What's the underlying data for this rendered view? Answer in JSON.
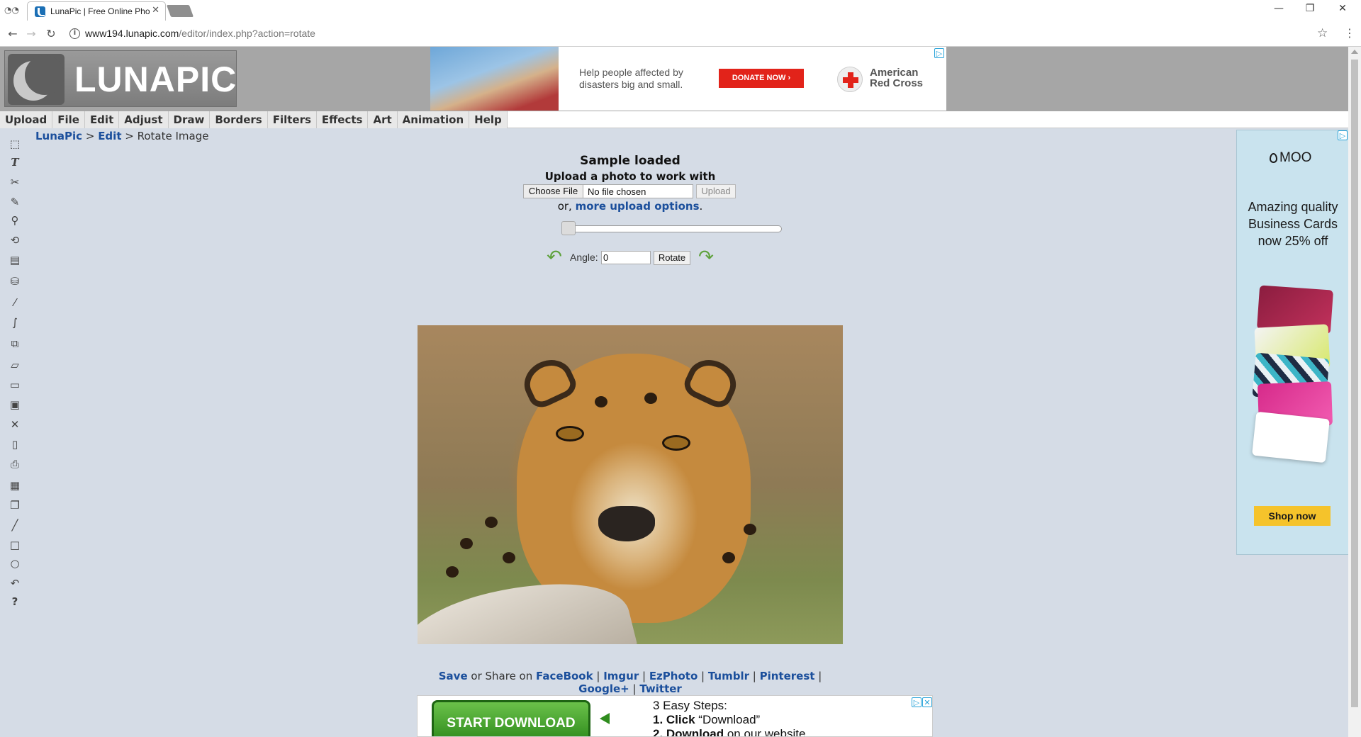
{
  "browser": {
    "tab_title": "LunaPic | Free Online Pho",
    "url_host": "www194.lunapic.com",
    "url_path": "/editor/index.php?action=rotate"
  },
  "logo": {
    "text": "LUNAPIC"
  },
  "top_ad": {
    "message": "Help people affected by disasters big and small.",
    "button": "DONATE NOW ›",
    "org_line1": "American",
    "org_line2": "Red Cross"
  },
  "menu": [
    "Upload",
    "File",
    "Edit",
    "Adjust",
    "Draw",
    "Borders",
    "Filters",
    "Effects",
    "Art",
    "Animation",
    "Help"
  ],
  "breadcrumb": {
    "home": "LunaPic",
    "sep1": " > ",
    "section": "Edit",
    "sep2": " > ",
    "current": "Rotate Image"
  },
  "upload": {
    "status": "Sample loaded",
    "prompt": "Upload a photo to work with",
    "choose_file": "Choose File",
    "no_file": "No file chosen",
    "upload_button": "Upload",
    "or_text": "or, ",
    "more_options": "more upload options",
    "period": "."
  },
  "rotate": {
    "slider_value": 0,
    "angle_label": "Angle:",
    "angle_value": "0",
    "rotate_button": "Rotate"
  },
  "share": {
    "save": "Save",
    "or_share": " or Share on ",
    "links": [
      "FaceBook",
      "Imgur",
      "EzPhoto",
      "Tumblr",
      "Pinterest",
      "Google+",
      "Twitter"
    ],
    "sep": " | "
  },
  "bottom_ad": {
    "button": "START DOWNLOAD",
    "steps_title": "3 Easy Steps:",
    "step1_bold": "1. Click",
    "step1_rest": "“Download”",
    "step2_bold": "2. Download",
    "step2_rest": " on our website"
  },
  "side_ad": {
    "brand": "MOO",
    "pitch": "Amazing quality Business Cards now 25% off",
    "button": "Shop now"
  }
}
